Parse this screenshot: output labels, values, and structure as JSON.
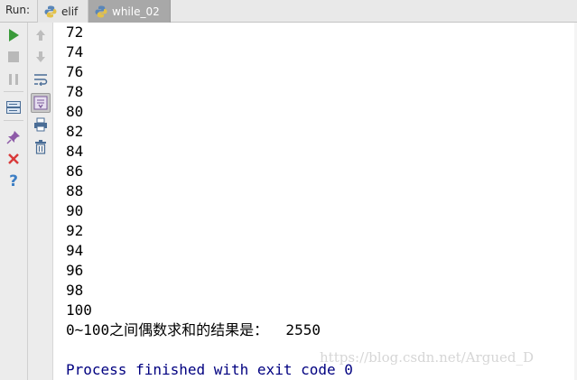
{
  "run_panel": {
    "label": "Run:",
    "tabs": [
      {
        "label": "elif",
        "active": false
      },
      {
        "label": "while_02",
        "active": true
      }
    ]
  },
  "toolbar": {
    "primary": [
      "rerun-icon",
      "stop-icon",
      "pause-icon",
      "layout-icon",
      "pin-icon",
      "close-icon",
      "help-icon"
    ],
    "secondary": [
      "up-arrow-icon",
      "down-arrow-icon",
      "soft-wrap-icon",
      "scroll-to-end-icon",
      "print-icon",
      "trash-icon"
    ]
  },
  "console": {
    "lines": [
      "72",
      "74",
      "76",
      "78",
      "80",
      "82",
      "84",
      "86",
      "88",
      "90",
      "92",
      "94",
      "96",
      "98",
      "100"
    ],
    "result_line": "0~100之间偶数求和的结果是：  2550",
    "exit_line": "Process finished with exit code 0"
  },
  "colors": {
    "exit_text": "#000080",
    "run_green": "#3a9a3a",
    "close_red": "#d93a3a"
  },
  "watermark": "https://blog.csdn.net/Argued_D"
}
